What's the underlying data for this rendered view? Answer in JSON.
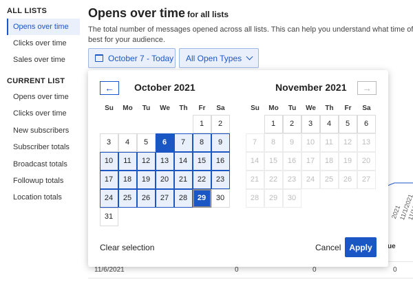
{
  "sidebar": {
    "all_lists_heading": "ALL LISTS",
    "all_lists": [
      "Opens over time",
      "Clicks over time",
      "Sales over time"
    ],
    "current_list_heading": "CURRENT LIST",
    "current_list": [
      "Opens over time",
      "Clicks over time",
      "New subscribers",
      "Subscriber totals",
      "Broadcast totals",
      "Followup totals",
      "Location totals"
    ]
  },
  "header": {
    "title": "Opens over time",
    "subtitle": "for all lists",
    "description_line1": "The total number of messages opened across all lists. This can help you understand what time of day o",
    "description_line2": "best for your audience."
  },
  "controls": {
    "date_button": "October 7 - Today",
    "types_button": "All Open Types"
  },
  "background": {
    "chart_ticks": [
      "2021",
      "11/1/2021",
      "11/1/2021"
    ],
    "column_header": "ue",
    "row": [
      "11/6/2021",
      "0",
      "0",
      "0"
    ]
  },
  "calendar": {
    "prev_label": "←",
    "next_label": "→",
    "weekdays": [
      "Su",
      "Mo",
      "Tu",
      "We",
      "Th",
      "Fr",
      "Sa"
    ],
    "left_month": "October 2021",
    "right_month": "November 2021",
    "clear_label": "Clear selection",
    "cancel_label": "Cancel",
    "apply_label": "Apply",
    "range_start": 6,
    "range_end": 29,
    "colors": {
      "accent": "#1a56c4",
      "range_fill": "#e9f0fb"
    }
  }
}
